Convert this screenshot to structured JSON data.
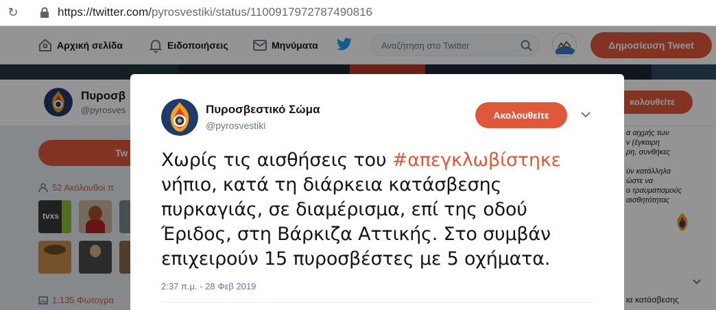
{
  "browser": {
    "url_host": "https://twitter.com/",
    "url_rest": "pyrosvestiki/status/1100917972787490816"
  },
  "nav": {
    "home": "Αρχική σελίδα",
    "notifications": "Ειδοποιήσεις",
    "messages": "Μηνύματα",
    "search_placeholder": "Αναζήτηση στο Twitter",
    "tweet_button": "Δημοσίευση Tweet"
  },
  "profile_bar": {
    "name": "Πυροσβ",
    "handle": "@pyrosves",
    "follow": "κολουθείτε"
  },
  "sidebar": {
    "button_label": "Tw",
    "followers": "52 Ακόλουθοι π",
    "photos": "1.135 Φωτογρα",
    "thumb_label": "tvxs"
  },
  "right_column": {
    "lines": [
      "α αιχμής των",
      "ν (έγκαιρη",
      "ρη, συνθήκες",
      "ύν κατάλληλα",
      "ώστε να",
      "ο τραυματισμούς",
      "αισθητότητας"
    ],
    "bottom": "ια κατάσβεσης"
  },
  "tweet": {
    "name": "Πυροσβεστικό Σώμα",
    "handle": "@pyrosvestiki",
    "follow_button": "Ακολουθείτε",
    "text_before": "Χωρίς τις αισθήσεις του ",
    "hashtag": "#απεγκλωβίστηκε",
    "text_after": " νήπιο, κατά τη διάρκεια κατάσβεσης πυρκαγιάς, σε διαμέρισμα, επί της οδού Έριδος, στη Βάρκιζα Αττικής. Στο συμβάν επιχειρούν 15 πυροσβέστες με 5 οχήματα.",
    "timestamp": "2:37 π.μ. - 28 Φεβ 2019"
  },
  "colors": {
    "accent": "#e0583c",
    "text": "#14171a",
    "muted": "#657786"
  }
}
